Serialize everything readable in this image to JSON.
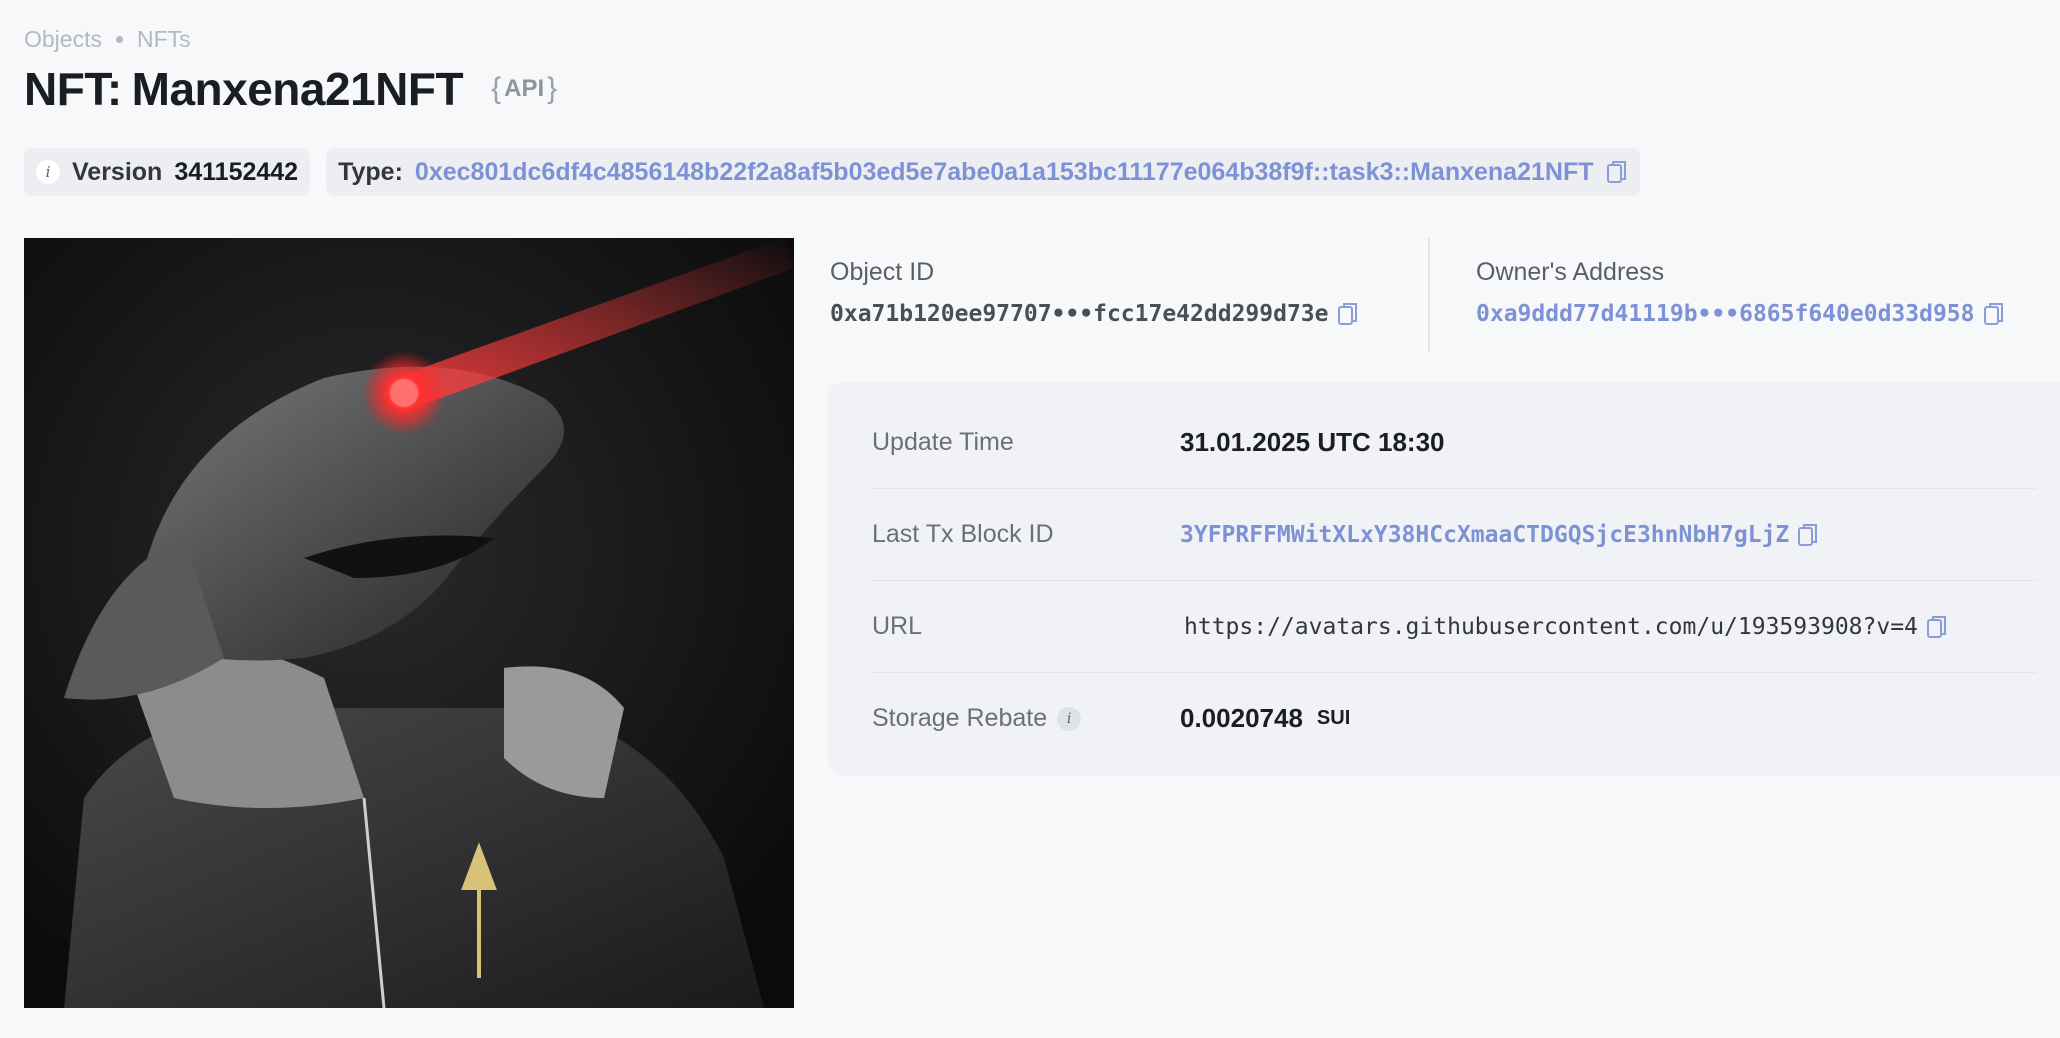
{
  "breadcrumb": {
    "items": [
      "Objects",
      "NFTs"
    ]
  },
  "header": {
    "prefix": "NFT:",
    "name": "Manxena21NFT",
    "api_label": "API"
  },
  "chips": {
    "version_label": "Version",
    "version_value": "341152442",
    "type_label": "Type:",
    "type_value": "0xec801dc6df4c4856148b22f2a8af5b03ed5e7abe0a1a153bc11177e064b38f9f::task3::Manxena21NFT"
  },
  "meta": {
    "object_id_label": "Object ID",
    "object_id_value": "0xa71b120ee97707•••fcc17e42dd299d73e",
    "owner_label": "Owner's Address",
    "owner_value": "0xa9ddd77d41119b•••6865f640e0d33d958"
  },
  "details": {
    "update_time_label": "Update Time",
    "update_time_value": "31.01.2025 UTC 18:30",
    "last_tx_label": "Last Tx Block ID",
    "last_tx_value": "3YFPRFFMWitXLxY38HCcXmaaCTDGQSjcE3hnNbH7gLjZ",
    "url_label": "URL",
    "url_value": "https://avatars.githubusercontent.com/u/193593908?v=4",
    "storage_label": "Storage Rebate",
    "storage_value": "0.0020748",
    "storage_unit": "SUI"
  },
  "icons": {
    "copy": "copy-icon",
    "info": "info-icon"
  },
  "colors": {
    "link": "#7d92d6",
    "background": "#f7f8fa",
    "card": "#f0f2f6"
  }
}
